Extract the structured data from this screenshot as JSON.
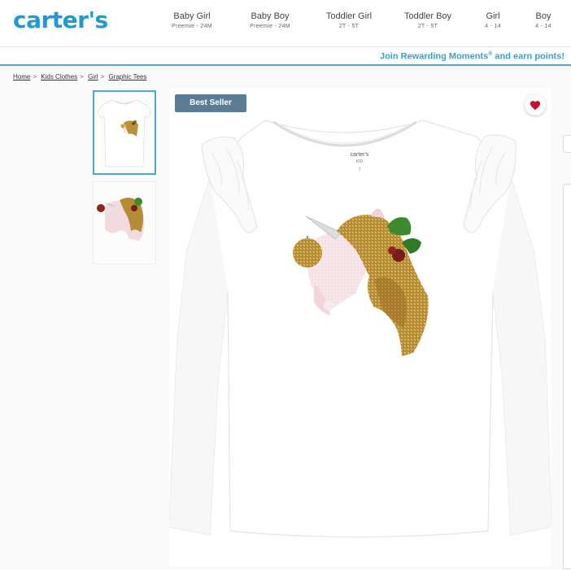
{
  "header": {
    "logo": "carter's",
    "nav": [
      {
        "label": "Baby Girl",
        "sub": "Preemie - 24M"
      },
      {
        "label": "Baby Boy",
        "sub": "Preemie - 24M"
      },
      {
        "label": "Toddler Girl",
        "sub": "2T - 5T"
      },
      {
        "label": "Toddler Boy",
        "sub": "2T - 5T"
      },
      {
        "label": "Girl",
        "sub": "4 - 14"
      },
      {
        "label": "Boy",
        "sub": "4 - 14"
      }
    ]
  },
  "promo": {
    "text_a": "Join Rewarding Moments",
    "reg": "®",
    "text_b": " and earn points!"
  },
  "breadcrumb": [
    "Home",
    "Kids Clothes",
    "Girl",
    "Graphic Tees"
  ],
  "product": {
    "badge": "Best Seller",
    "tag_brand": "carter's",
    "tag_sub": "KID",
    "tag_size": "7"
  },
  "colors": {
    "brand": "#1f9ad6",
    "accent": "#3aa0c8",
    "badge": "#5b7c95",
    "heart": "#c8102e"
  },
  "icons": [
    "heart-icon"
  ]
}
